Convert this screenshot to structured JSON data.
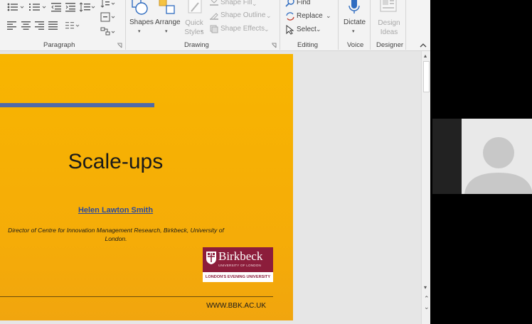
{
  "ribbon": {
    "groups": {
      "paragraph": "Paragraph",
      "drawing": "Drawing",
      "editing": "Editing",
      "voice": "Voice",
      "designer": "Designer"
    },
    "drawing": {
      "shapes": "Shapes",
      "arrange": "Arrange",
      "quick_styles": "Quick Styles",
      "shape_fill": "Shape Fill",
      "shape_outline": "Shape Outline",
      "shape_effects": "Shape Effects"
    },
    "editing": {
      "find": "Find",
      "replace": "Replace",
      "select": "Select"
    },
    "voice": {
      "dictate": "Dictate"
    },
    "designer": {
      "design_ideas": "Design Ideas"
    }
  },
  "slide": {
    "title": "Scale-ups",
    "presenter": "Helen Lawton Smith",
    "affiliation": "Director of Centre for Innovation Management Research, Birkbeck, University of London.",
    "logo_name": "Birkbeck",
    "logo_subtitle": "UNIVERSITY OF LONDON",
    "logo_tagline": "LONDON'S EVENING UNIVERSITY",
    "footer_url": "WWW.BBK.AC.UK"
  },
  "colors": {
    "slide_bg": "#f8b500",
    "accent_bar": "#4f6aa8",
    "brand": "#8c1d3b",
    "link": "#2e4a9a"
  }
}
